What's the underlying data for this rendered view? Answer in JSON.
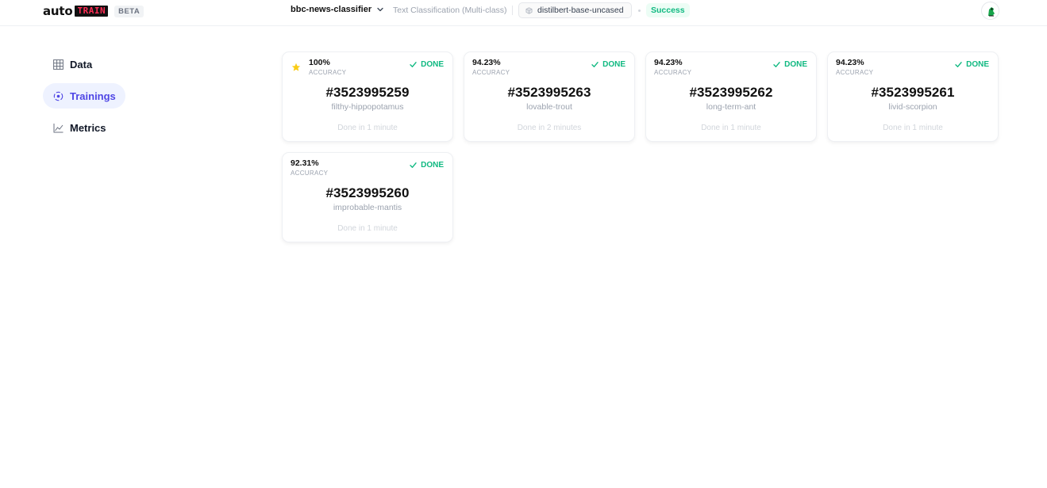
{
  "header": {
    "logo_auto": "auto",
    "logo_train": "TRAIN",
    "beta": "BETA",
    "project_name": "bbc-news-classifier",
    "task": "Text Classification (Multi-class)",
    "model": "distilbert-base-uncased",
    "status": "Success",
    "status_color": "#10b981"
  },
  "sidebar": {
    "items": [
      {
        "label": "Data",
        "icon": "grid-icon"
      },
      {
        "label": "Trainings",
        "icon": "target-icon"
      },
      {
        "label": "Metrics",
        "icon": "chart-line-icon"
      }
    ],
    "active_index": 1,
    "accent": "#4f46e5"
  },
  "trainings": {
    "accuracy_label": "ACCURACY",
    "done_label": "DONE",
    "cards": [
      {
        "accuracy": "100%",
        "id": "#3523995259",
        "name": "filthy-hippopotamus",
        "duration": "Done in 1 minute",
        "best": true
      },
      {
        "accuracy": "94.23%",
        "id": "#3523995263",
        "name": "lovable-trout",
        "duration": "Done in 2 minutes",
        "best": false
      },
      {
        "accuracy": "94.23%",
        "id": "#3523995262",
        "name": "long-term-ant",
        "duration": "Done in 1 minute",
        "best": false
      },
      {
        "accuracy": "94.23%",
        "id": "#3523995261",
        "name": "livid-scorpion",
        "duration": "Done in 1 minute",
        "best": false
      },
      {
        "accuracy": "92.31%",
        "id": "#3523995260",
        "name": "improbable-mantis",
        "duration": "Done in 1 minute",
        "best": false
      }
    ]
  }
}
